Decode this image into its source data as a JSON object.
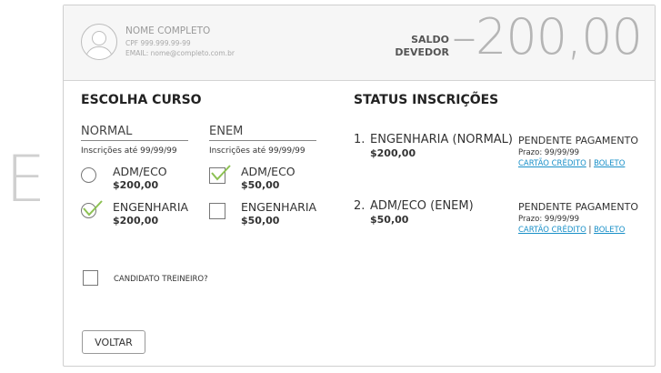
{
  "side_letter": "E",
  "user": {
    "name": "NOME COMPLETO",
    "cpf": "CPF 999.999.99-99",
    "email": "EMAIL: nome@completo.com.br"
  },
  "balance": {
    "label_line1": "SALDO",
    "label_line2": "DEVEDOR",
    "value": "–200,00"
  },
  "choose_course": {
    "title": "ESCOLHA CURSO",
    "columns": [
      {
        "header": "NORMAL",
        "note": "Inscrições até  99/99/99",
        "control": "radio",
        "options": [
          {
            "label": "ADM/ECO",
            "price": "$200,00",
            "selected": false
          },
          {
            "label": "ENGENHARIA",
            "price": "$200,00",
            "selected": true
          }
        ]
      },
      {
        "header": "ENEM",
        "note": "Inscrições até  99/99/99",
        "control": "checkbox",
        "options": [
          {
            "label": "ADM/ECO",
            "price": "$50,00",
            "selected": true
          },
          {
            "label": "ENGENHARIA",
            "price": "$50,00",
            "selected": false
          }
        ]
      }
    ],
    "treineiro_label": "CANDIDATO TREINEIRO?",
    "back_button": "VOLTAR"
  },
  "status": {
    "title": "STATUS INSCRIÇÕES",
    "items": [
      {
        "number": "1.",
        "name": "ENGENHARIA (NORMAL)",
        "price": "$200,00",
        "state": "PENDENTE PAGAMENTO",
        "prazo": "Prazo: 99/99/99",
        "link1": "CARTÃO CRÉDITO",
        "separator": "|",
        "link2": "BOLETO"
      },
      {
        "number": "2.",
        "name": "ADM/ECO (ENEM)",
        "price": "$50,00",
        "state": "PENDENTE PAGAMENTO",
        "prazo": "Prazo: 99/99/99",
        "link1": "CARTÃO CRÉDITO",
        "separator": "|",
        "link2": "BOLETO"
      }
    ]
  },
  "colors": {
    "check": "#8cc152",
    "link": "#1a90c8",
    "balance": "#b5b5b5"
  }
}
